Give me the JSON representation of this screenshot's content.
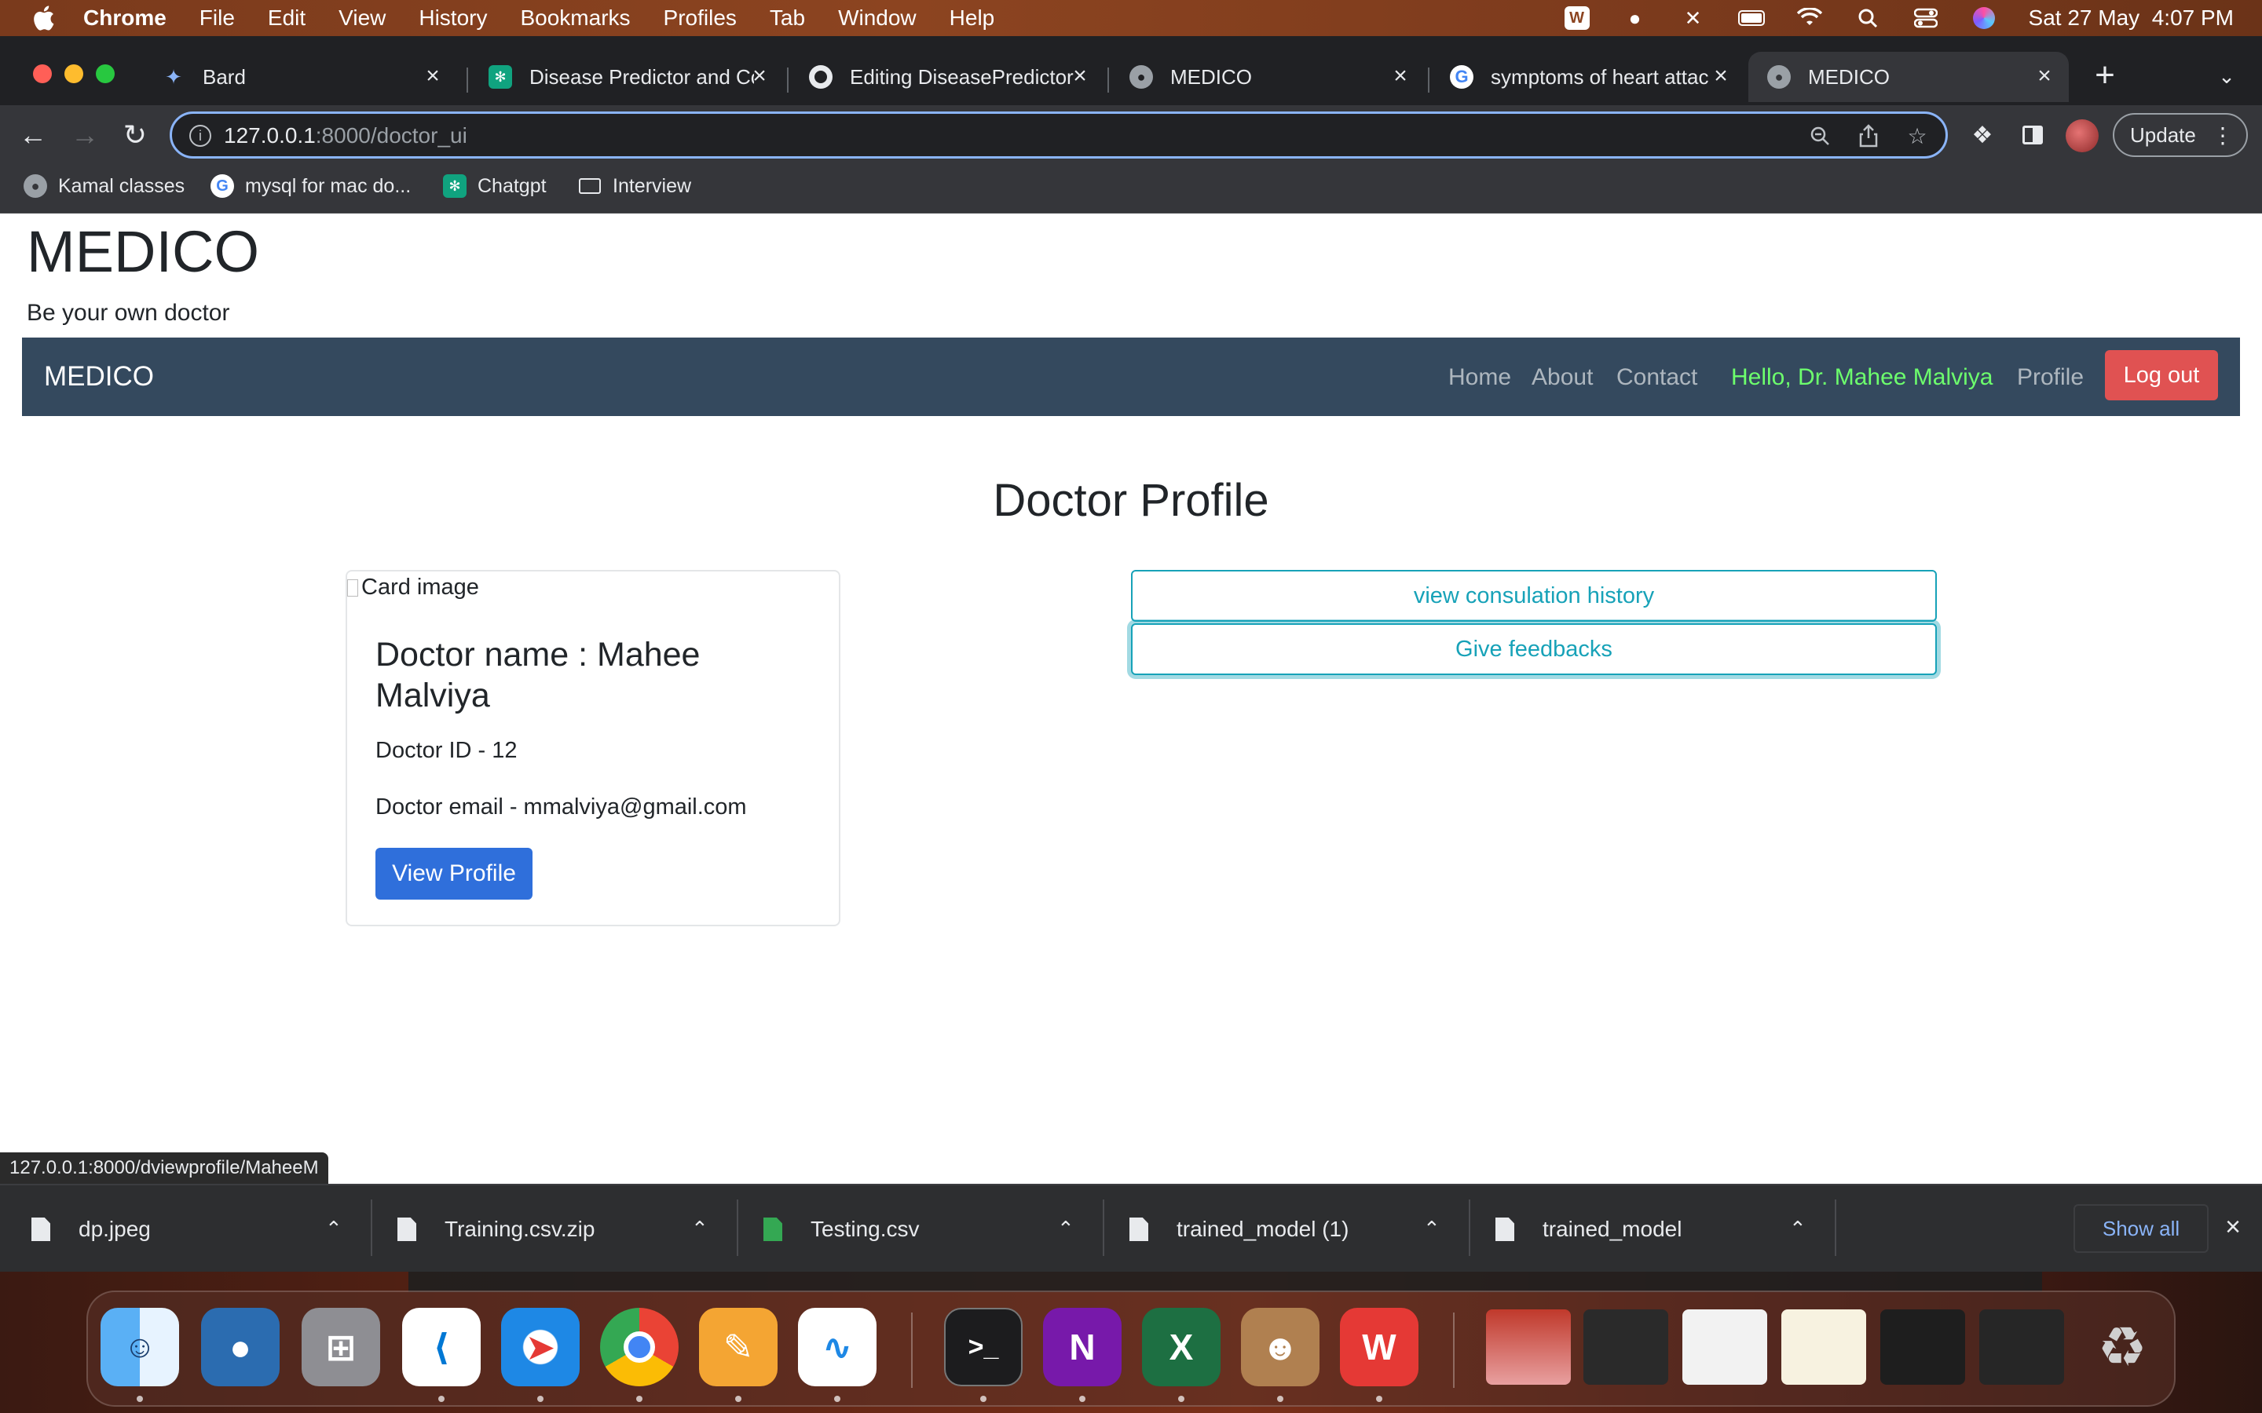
{
  "menubar": {
    "app": "Chrome",
    "items": [
      "File",
      "Edit",
      "View",
      "History",
      "Bookmarks",
      "Profiles",
      "Tab",
      "Window",
      "Help"
    ],
    "clock": "Sat 27 May  4:07 PM"
  },
  "tabs": [
    {
      "title": "Bard",
      "icon": "bard-icon",
      "active": false
    },
    {
      "title": "Disease Predictor and Co",
      "icon": "chatgpt-icon",
      "active": false
    },
    {
      "title": "Editing DiseasePredictor",
      "icon": "github-icon",
      "active": false
    },
    {
      "title": "MEDICO",
      "icon": "globe-icon",
      "active": false
    },
    {
      "title": "symptoms of heart attac",
      "icon": "google-icon",
      "active": false
    },
    {
      "title": "MEDICO",
      "icon": "globe-icon",
      "active": true
    }
  ],
  "omnibox": {
    "host": "127.0.0.1",
    "path": ":8000/doctor_ui"
  },
  "toolbar": {
    "update_label": "Update"
  },
  "bookmarks": [
    {
      "label": "Kamal classes",
      "icon": "globe-icon"
    },
    {
      "label": "mysql for mac do...",
      "icon": "google-icon"
    },
    {
      "label": "Chatgpt",
      "icon": "chatgpt-icon"
    },
    {
      "label": "Interview",
      "icon": "folder-icon"
    }
  ],
  "site": {
    "brand": "MEDICO",
    "tagline": "Be your own doctor",
    "nav": {
      "brand": "MEDICO",
      "home": "Home",
      "about": "About",
      "contact": "Contact",
      "hello": "Hello, Dr. Mahee Malviya",
      "profile": "Profile",
      "logout": "Log out"
    },
    "page_title": "Doctor Profile",
    "card": {
      "image_alt": "Card image",
      "name": "Doctor name : Mahee Malviya",
      "id": "Doctor ID - 12",
      "email": "Doctor email - mmalviya@gmail.com",
      "view_profile": "View Profile"
    },
    "actions": {
      "history": "view consulation history",
      "feedback": "Give feedbacks"
    }
  },
  "status_url": "127.0.0.1:8000/dviewprofile/MaheeM",
  "downloads": [
    {
      "name": "dp.jpeg",
      "type": "file"
    },
    {
      "name": "Training.csv.zip",
      "type": "file"
    },
    {
      "name": "Testing.csv",
      "type": "csv"
    },
    {
      "name": "trained_model (1)",
      "type": "file"
    },
    {
      "name": "trained_model",
      "type": "file"
    }
  ],
  "shelf": {
    "show_all": "Show all"
  },
  "dock": [
    "finder",
    "tableplus",
    "launchpad",
    "vscode",
    "safari",
    "chrome",
    "pages",
    "freeform",
    "terminal",
    "onenote",
    "excel",
    "contacts",
    "wps-office"
  ],
  "colors": {
    "navbar": "#34495e",
    "hello": "#6dff6d",
    "logout": "#e05252",
    "primary": "#2f6fdb",
    "info": "#17a2b8"
  }
}
